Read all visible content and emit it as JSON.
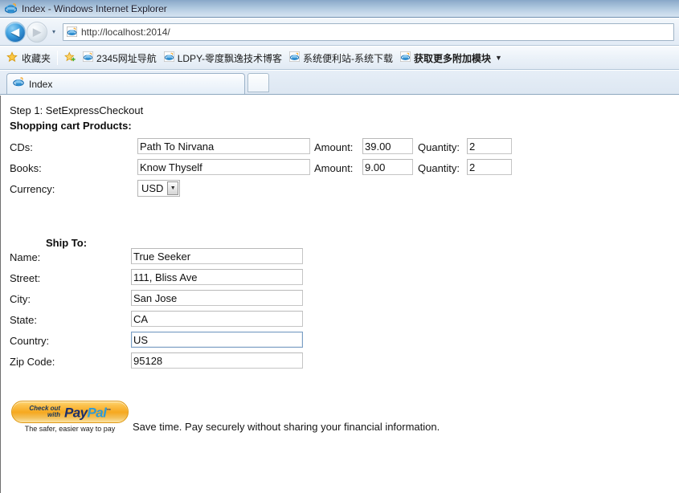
{
  "window": {
    "title": "Index - Windows Internet Explorer",
    "icon": "ie-logo-icon"
  },
  "navigation": {
    "back_label": "◀",
    "forward_label": "▶",
    "recent_pages_caret": "▾",
    "address_value": "http://localhost:2014/",
    "address_placeholder": "http://localhost:2014/"
  },
  "favorites_bar": {
    "root_label": "收藏夹",
    "add_to_favorites_title": "add-to-favorites",
    "links": [
      {
        "label": "2345网址导航",
        "bold": false
      },
      {
        "label": "LDPY-零度飘逸技术博客",
        "bold": false
      },
      {
        "label": "系统便利站-系统下载",
        "bold": false
      },
      {
        "label": "获取更多附加模块",
        "bold": true
      }
    ],
    "overflow_caret": "▼"
  },
  "tabs": {
    "items": [
      {
        "label": "Index",
        "active": true
      }
    ],
    "new_tab_label": ""
  },
  "page": {
    "step_title": "Step 1: SetExpressCheckout",
    "cart_heading": "Shopping cart Products:",
    "cart_rows": [
      {
        "label": "CDs:",
        "product_value": "Path To Nirvana",
        "amount_label": "Amount:",
        "amount_value": "39.00",
        "quantity_label": "Quantity:",
        "quantity_value": "2"
      },
      {
        "label": "Books:",
        "product_value": "Know Thyself",
        "amount_label": "Amount:",
        "amount_value": "9.00",
        "quantity_label": "Quantity:",
        "quantity_value": "2"
      }
    ],
    "currency": {
      "label": "Currency:",
      "value": "USD",
      "options": [
        "USD"
      ],
      "arrow": "▼"
    },
    "shipto_heading": "Ship To:",
    "shipto_fields": [
      {
        "label": "Name:",
        "value": "True Seeker",
        "focused": false
      },
      {
        "label": "Street:",
        "value": "111, Bliss Ave",
        "focused": false
      },
      {
        "label": "City:",
        "value": "San Jose",
        "focused": false
      },
      {
        "label": "State:",
        "value": "CA",
        "focused": false
      },
      {
        "label": "Country:",
        "value": "US",
        "focused": true
      },
      {
        "label": "Zip Code:",
        "value": "95128",
        "focused": false
      }
    ],
    "paypal": {
      "check_out": "Check out",
      "with": "with",
      "brand_pay": "Pay",
      "brand_pal": "Pal",
      "trademark": "™",
      "tagline": "The safer, easier way to pay",
      "note": "Save time. Pay securely without sharing your financial information."
    }
  },
  "colors": {
    "titlebar_top": "#87a7c8",
    "titlebar_bottom": "#d5e3f1",
    "paypal_orange": "#f6a81f",
    "paypal_navy": "#1b2f6b",
    "paypal_blue": "#2f9bd6",
    "focus_border": "#7a9ec4"
  }
}
